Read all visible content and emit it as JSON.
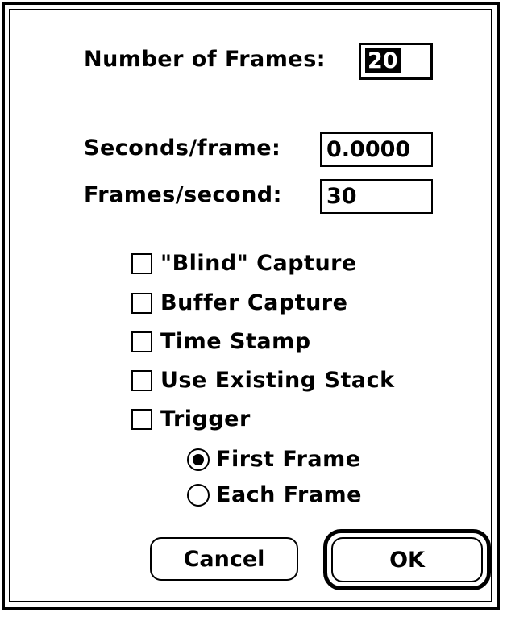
{
  "frames": {
    "number_label": "Number of Frames:",
    "number_value": "20",
    "seconds_label": "Seconds/frame:",
    "seconds_value": "0.0000",
    "fps_label": "Frames/second:",
    "fps_value": "30"
  },
  "options": [
    {
      "label": "\"Blind\" Capture",
      "checked": false
    },
    {
      "label": "Buffer Capture",
      "checked": false
    },
    {
      "label": "Time Stamp",
      "checked": false
    },
    {
      "label": "Use Existing Stack",
      "checked": false
    },
    {
      "label": "Trigger",
      "checked": false
    }
  ],
  "trigger_modes": [
    {
      "label": "First Frame",
      "selected": true
    },
    {
      "label": "Each Frame",
      "selected": false
    }
  ],
  "buttons": {
    "cancel": "Cancel",
    "ok": "OK"
  }
}
